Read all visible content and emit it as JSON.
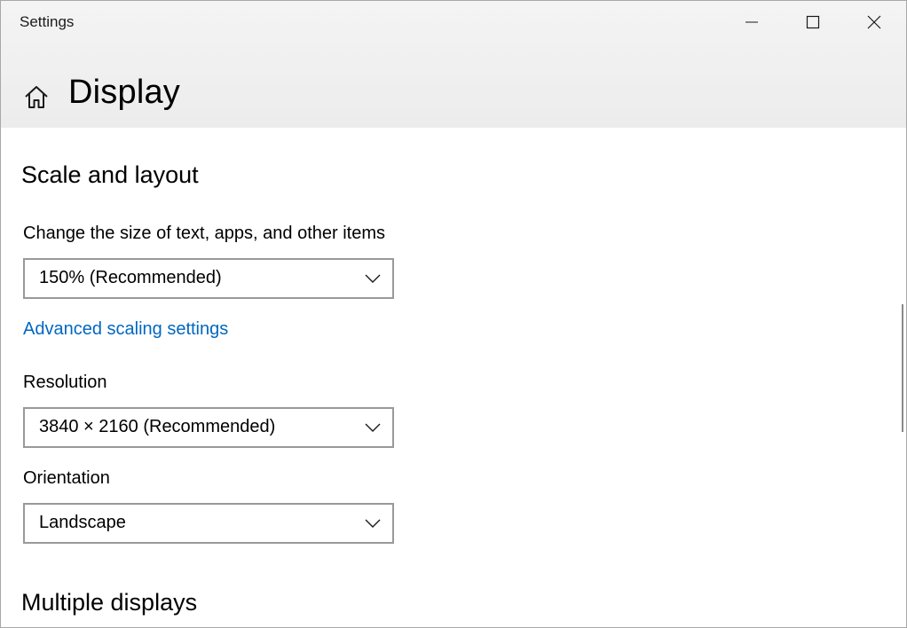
{
  "window": {
    "app_title": "Settings",
    "icons": {
      "minimize": "minimize-icon",
      "maximize": "maximize-icon",
      "close": "close-icon",
      "home": "home-icon"
    }
  },
  "header": {
    "page_title": "Display"
  },
  "scale_layout": {
    "heading": "Scale and layout",
    "size_label": "Change the size of text, apps, and other items",
    "size_value": "150% (Recommended)",
    "advanced_link": "Advanced scaling settings",
    "resolution_label": "Resolution",
    "resolution_value": "3840 × 2160 (Recommended)",
    "orientation_label": "Orientation",
    "orientation_value": "Landscape"
  },
  "multiple_displays": {
    "heading": "Multiple displays"
  },
  "colors": {
    "link": "#0067c0",
    "header_background": "#f0f0f0",
    "dropdown_border": "#999999"
  }
}
